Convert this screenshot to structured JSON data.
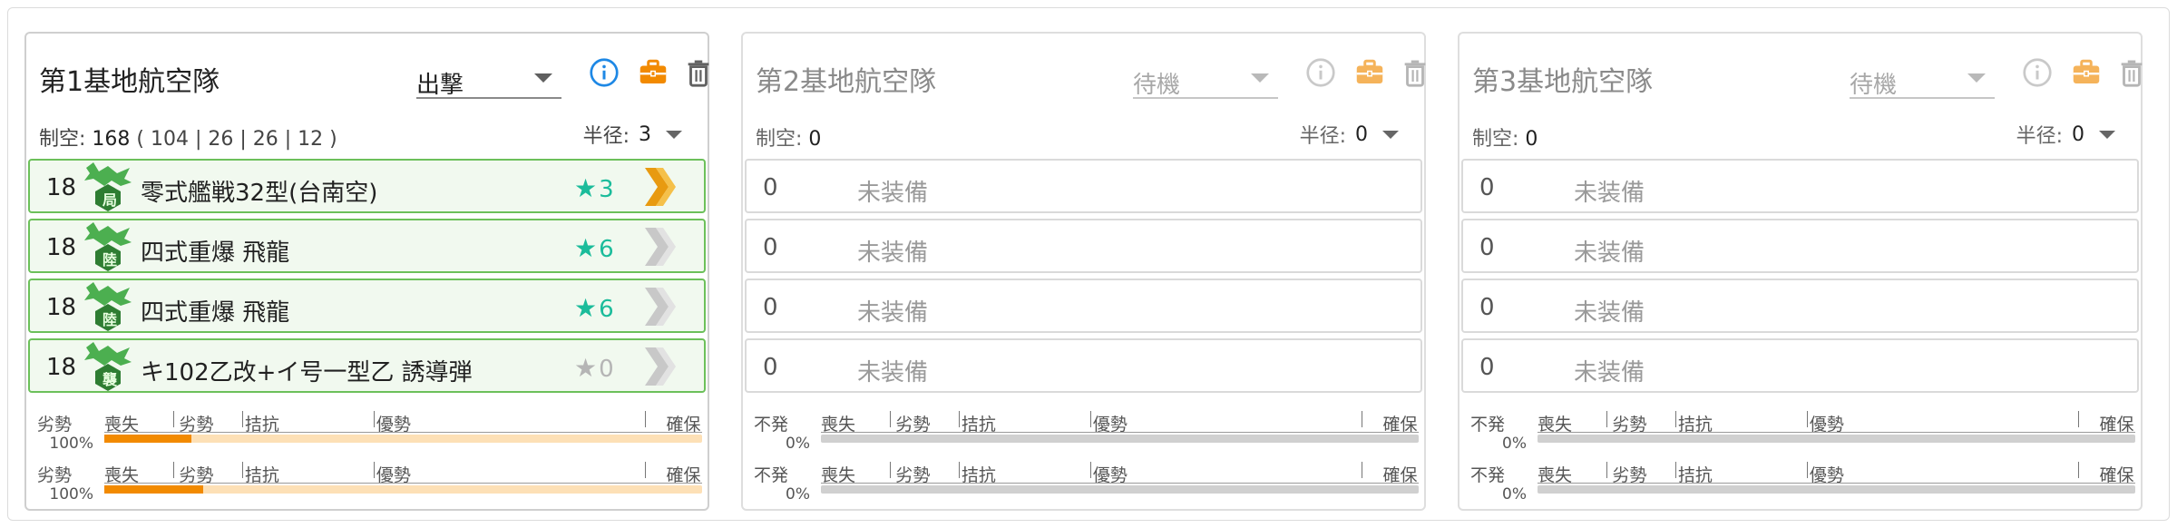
{
  "colors": {
    "accent_blue": "#1e88e5",
    "accent_orange": "#f28a00",
    "star_teal": "#1bbc9b",
    "slot_border_green": "#6cc05a",
    "gauge_track": "#fde0b6",
    "gauge_track_empty": "#d0d0d0"
  },
  "panels": [
    {
      "title": "第1基地航空隊",
      "mode": "出撃",
      "active": true,
      "air_label": "制空:",
      "air_value": "168",
      "air_breakdown": "( 104 | 26 | 26 | 12 )",
      "radius_label": "半径:",
      "radius_value": "3",
      "slots": [
        {
          "count": "18",
          "name": "零式艦戦32型(台南空)",
          "icon": "fighter-land-icon",
          "icon_letter": "局",
          "star": "3",
          "star_filled": true,
          "chevron": "orange"
        },
        {
          "count": "18",
          "name": "四式重爆 飛龍",
          "icon": "bomber-land-icon",
          "icon_letter": "陸",
          "star": "6",
          "star_filled": true,
          "chevron": "gray"
        },
        {
          "count": "18",
          "name": "四式重爆 飛龍",
          "icon": "bomber-land-icon",
          "icon_letter": "陸",
          "star": "6",
          "star_filled": true,
          "chevron": "gray"
        },
        {
          "count": "18",
          "name": "キ102乙改+イ号一型乙 誘導弾",
          "icon": "attacker-land-icon",
          "icon_letter": "襲",
          "star": "0",
          "star_filled": false,
          "chevron": "gray"
        }
      ],
      "gauges": [
        {
          "state": "劣勢",
          "percent": "100%",
          "fill": 0.145
        },
        {
          "state": "劣勢",
          "percent": "100%",
          "fill": 0.165
        }
      ]
    },
    {
      "title": "第2基地航空隊",
      "mode": "待機",
      "active": false,
      "air_label": "制空:",
      "air_value": "0",
      "air_breakdown": "",
      "radius_label": "半径:",
      "radius_value": "0",
      "slots": [
        {
          "count": "0",
          "name": "未装備"
        },
        {
          "count": "0",
          "name": "未装備"
        },
        {
          "count": "0",
          "name": "未装備"
        },
        {
          "count": "0",
          "name": "未装備"
        }
      ],
      "gauges": [
        {
          "state": "不発",
          "percent": "0%",
          "fill": 0
        },
        {
          "state": "不発",
          "percent": "0%",
          "fill": 0
        }
      ]
    },
    {
      "title": "第3基地航空隊",
      "mode": "待機",
      "active": false,
      "air_label": "制空:",
      "air_value": "0",
      "air_breakdown": "",
      "radius_label": "半径:",
      "radius_value": "0",
      "slots": [
        {
          "count": "0",
          "name": "未装備"
        },
        {
          "count": "0",
          "name": "未装備"
        },
        {
          "count": "0",
          "name": "未装備"
        },
        {
          "count": "0",
          "name": "未装備"
        }
      ],
      "gauges": [
        {
          "state": "不発",
          "percent": "0%",
          "fill": 0
        },
        {
          "state": "不発",
          "percent": "0%",
          "fill": 0
        }
      ]
    }
  ],
  "gauge_scale": [
    "喪失",
    "劣勢",
    "拮抗",
    "優勢",
    "確保"
  ]
}
